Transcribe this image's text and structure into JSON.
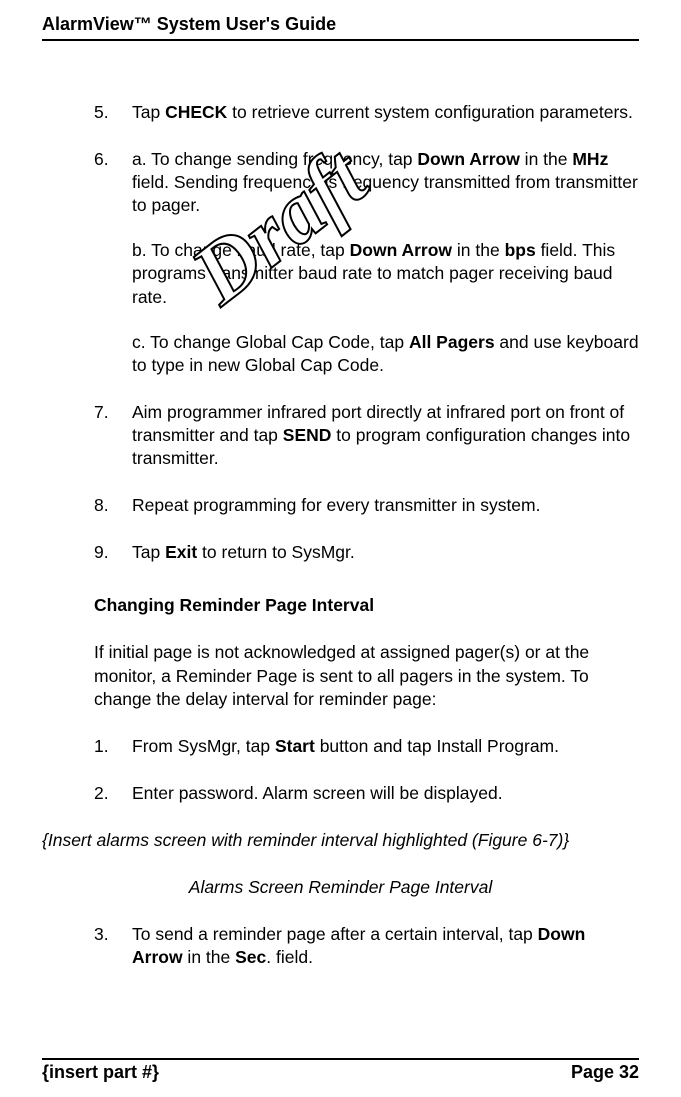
{
  "header": {
    "title": "AlarmView™ System User's Guide"
  },
  "steps_a": [
    {
      "n": "5.",
      "parts": [
        {
          "runs": [
            {
              "t": "Tap "
            },
            {
              "t": "CHECK",
              "b": true
            },
            {
              "t": " to retrieve current system configuration parameters."
            }
          ]
        }
      ]
    },
    {
      "n": "6.",
      "parts": [
        {
          "runs": [
            {
              "t": "a. To change sending frequency, tap "
            },
            {
              "t": "Down Arrow",
              "b": true
            },
            {
              "t": " in the "
            },
            {
              "t": "MHz",
              "b": true
            },
            {
              "t": " field. Sending frequency is frequency transmitted from transmitter to pager."
            }
          ]
        },
        {
          "runs": [
            {
              "t": "b. To change baud rate, tap "
            },
            {
              "t": "Down Arrow",
              "b": true
            },
            {
              "t": " in the "
            },
            {
              "t": "bps",
              "b": true
            },
            {
              "t": " field. This programs transmitter baud rate to match pager receiving baud rate."
            }
          ]
        },
        {
          "runs": [
            {
              "t": "c. To change Global Cap Code, tap "
            },
            {
              "t": "All Pagers",
              "b": true
            },
            {
              "t": " and use keyboard to type in new Global Cap Code."
            }
          ]
        }
      ]
    },
    {
      "n": "7.",
      "parts": [
        {
          "runs": [
            {
              "t": "Aim programmer infrared port directly at infrared port on front of transmitter and tap "
            },
            {
              "t": "SEND",
              "b": true
            },
            {
              "t": " to program configuration changes into transmitter."
            }
          ]
        }
      ]
    },
    {
      "n": "8.",
      "parts": [
        {
          "runs": [
            {
              "t": "Repeat programming for every transmitter in system."
            }
          ]
        }
      ]
    },
    {
      "n": "9.",
      "parts": [
        {
          "runs": [
            {
              "t": "Tap "
            },
            {
              "t": "Exit",
              "b": true
            },
            {
              "t": " to return to SysMgr."
            }
          ]
        }
      ]
    }
  ],
  "section": {
    "heading": "Changing Reminder Page Interval",
    "intro": "If initial page is not acknowledged at assigned pager(s) or at the monitor, a Reminder Page is sent to all pagers in the system. To change the delay interval for reminder page:"
  },
  "steps_b": [
    {
      "n": "1.",
      "parts": [
        {
          "runs": [
            {
              "t": "From SysMgr, tap "
            },
            {
              "t": "Start",
              "b": true
            },
            {
              "t": " button and tap Install Program."
            }
          ]
        }
      ]
    },
    {
      "n": "2.",
      "parts": [
        {
          "runs": [
            {
              "t": "Enter password. Alarm screen will be displayed."
            }
          ]
        }
      ]
    }
  ],
  "insert_note": "{Insert alarms screen with reminder interval highlighted (Figure 6-7)}",
  "caption": "Alarms Screen Reminder Page Interval",
  "steps_c": [
    {
      "n": "3.",
      "parts": [
        {
          "runs": [
            {
              "t": "To send a reminder page after a certain interval, tap "
            },
            {
              "t": "Down Arrow",
              "b": true
            },
            {
              "t": " in the "
            },
            {
              "t": "Sec",
              "b": true
            },
            {
              "t": ". field."
            }
          ]
        }
      ]
    }
  ],
  "footer": {
    "left": "{insert part #}",
    "right": "Page 32"
  },
  "watermark": {
    "text": "Draft"
  }
}
